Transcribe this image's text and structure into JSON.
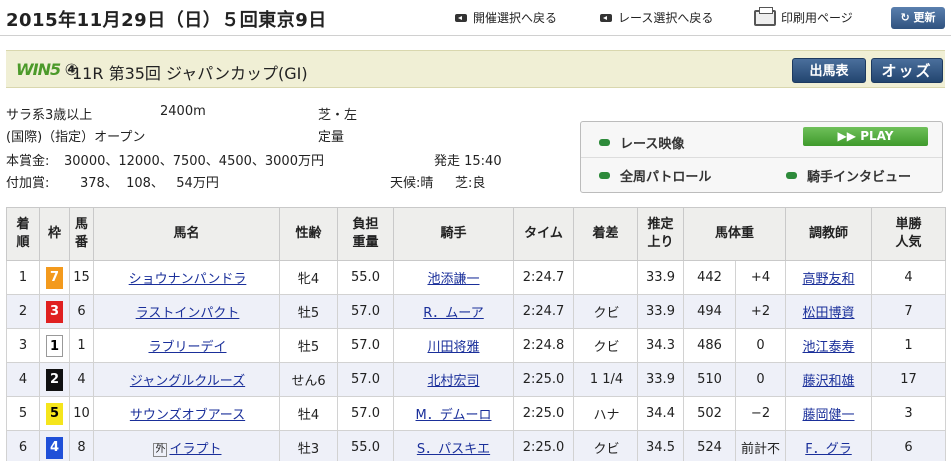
{
  "header": {
    "date": "2015年11月29日（日）５回東京9日",
    "nav_meeting": "開催選択へ戻る",
    "nav_race": "レース選択へ戻る",
    "nav_print": "印刷用ページ",
    "refresh": "更新"
  },
  "race": {
    "win5_badge": "WIN5",
    "win5_number": "④",
    "title": "11R 第35回 ジャパンカップ(GI)",
    "btn_shutuba": "出馬表",
    "btn_odds": "オッズ"
  },
  "info": {
    "class": "サラ系3歳以上",
    "distance": "2400m",
    "course": "芝・左",
    "conditions": "(国際)（指定）オープン",
    "weight_rule": "定量",
    "prize_label": "本賞金:",
    "prize": "30000、12000、7500、4500、3000万円",
    "post_time": "発走 15:40",
    "bonus_label": "付加賞:",
    "bonus": "378、  108、   54万円",
    "weather": "天候:晴",
    "track": "芝:良"
  },
  "video": {
    "race_video": "レース映像",
    "play": "PLAY",
    "patrol": "全周パトロール",
    "interview": "騎手インタビュー"
  },
  "table": {
    "headers": [
      "着\n順",
      "枠",
      "馬\n番",
      "馬名",
      "性齢",
      "負担\n重量",
      "騎手",
      "タイム",
      "着差",
      "推定\n上り",
      "馬体重",
      "",
      "調教師",
      "単勝\n人気"
    ],
    "rows": [
      {
        "pos": "1",
        "waku": "7",
        "waku_bg": "#f39a1d",
        "waku_fg": "#ffffff",
        "num": "15",
        "tag": "",
        "horse": "ショウナンパンドラ",
        "sex_age": "牝4",
        "weight": "55.0",
        "jockey": "池添謙一",
        "time": "2:24.7",
        "margin": "",
        "agari": "33.9",
        "body": "442",
        "diff": "+4",
        "trainer": "高野友和",
        "pop": "4"
      },
      {
        "pos": "2",
        "waku": "3",
        "waku_bg": "#e02020",
        "waku_fg": "#ffffff",
        "num": "6",
        "tag": "",
        "horse": "ラストインパクト",
        "sex_age": "牡5",
        "weight": "57.0",
        "jockey": "R．ムーア",
        "time": "2:24.7",
        "margin": "クビ",
        "agari": "33.9",
        "body": "494",
        "diff": "+2",
        "trainer": "松田博資",
        "pop": "7"
      },
      {
        "pos": "3",
        "waku": "1",
        "waku_bg": "#ffffff",
        "waku_fg": "#000000",
        "num": "1",
        "tag": "",
        "horse": "ラブリーデイ",
        "sex_age": "牡5",
        "weight": "57.0",
        "jockey": "川田将雅",
        "time": "2:24.8",
        "margin": "クビ",
        "agari": "34.3",
        "body": "486",
        "diff": "0",
        "trainer": "池江泰寿",
        "pop": "1"
      },
      {
        "pos": "4",
        "waku": "2",
        "waku_bg": "#111111",
        "waku_fg": "#ffffff",
        "num": "4",
        "tag": "",
        "horse": "ジャングルクルーズ",
        "sex_age": "せん6",
        "weight": "57.0",
        "jockey": "北村宏司",
        "time": "2:25.0",
        "margin": "1 1/4",
        "agari": "33.9",
        "body": "510",
        "diff": "0",
        "trainer": "藤沢和雄",
        "pop": "17"
      },
      {
        "pos": "5",
        "waku": "5",
        "waku_bg": "#f5e51c",
        "waku_fg": "#000000",
        "num": "10",
        "tag": "",
        "horse": "サウンズオブアース",
        "sex_age": "牡4",
        "weight": "57.0",
        "jockey": "M．デムーロ",
        "time": "2:25.0",
        "margin": "ハナ",
        "agari": "34.4",
        "body": "502",
        "diff": "−2",
        "trainer": "藤岡健一",
        "pop": "3"
      },
      {
        "pos": "6",
        "waku": "4",
        "waku_bg": "#2050d8",
        "waku_fg": "#ffffff",
        "num": "8",
        "tag": "外",
        "horse": "イラプト",
        "sex_age": "牡3",
        "weight": "55.0",
        "jockey": "S．パスキエ",
        "time": "2:25.0",
        "margin": "クビ",
        "agari": "34.5",
        "body": "524",
        "diff": "前計不",
        "trainer": "F．グラ",
        "pop": "6"
      }
    ]
  }
}
